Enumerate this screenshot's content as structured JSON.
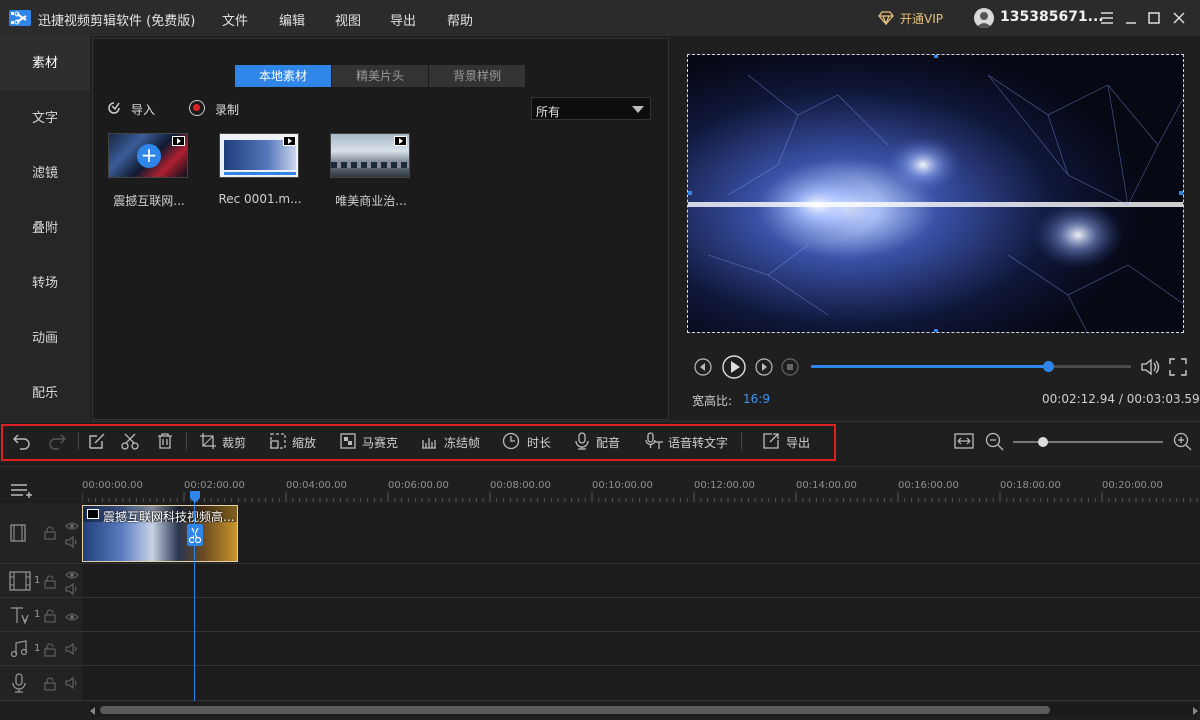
{
  "app": {
    "title": "迅捷视频剪辑软件 (免费版)"
  },
  "menu": [
    "文件",
    "编辑",
    "视图",
    "导出",
    "帮助"
  ],
  "account": {
    "vip_label": "开通VIP",
    "username": "135385671..."
  },
  "sidenav": [
    "素材",
    "文字",
    "滤镜",
    "叠附",
    "转场",
    "动画",
    "配乐"
  ],
  "media": {
    "tabs": [
      "本地素材",
      "精美片头",
      "背景样例"
    ],
    "import_label": "导入",
    "record_label": "录制",
    "filter_value": "所有",
    "items": [
      "震撼互联网...",
      "Rec 0001.m...",
      "唯美商业治..."
    ]
  },
  "preview": {
    "current_time": "00:02:12.94",
    "total_time": "00:03:03.59",
    "time_separator": "/",
    "progress": 0.74,
    "aspect_label": "宽高比:",
    "aspect_value": "16:9"
  },
  "toolbar": {
    "crop": "裁剪",
    "zoom": "缩放",
    "mosaic": "马赛克",
    "freeze": "冻结帧",
    "duration": "时长",
    "dub": "配音",
    "speech_to_text": "语音转文字",
    "export": "导出",
    "timeline_zoom": 0.1
  },
  "timeline": {
    "ticks": [
      "00:00:00.00",
      "00:02:00.00",
      "00:04:00.00",
      "00:06:00.00",
      "00:08:00.00",
      "00:10:00.00",
      "00:12:00.00",
      "00:14:00.00",
      "00:16:00.00",
      "00:18:00.00",
      "00:20:00.00"
    ],
    "clip_title": "震撼互联网科技视频高...",
    "track_numbers": [
      "1",
      "1",
      "1"
    ]
  },
  "colors": {
    "accent": "#2f86e8",
    "highlight_frame": "#e02020",
    "vip": "#e6c079"
  }
}
